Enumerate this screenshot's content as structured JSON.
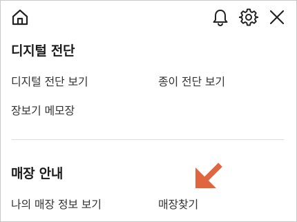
{
  "header": {
    "home_icon": "home-icon",
    "bell_icon": "bell-icon",
    "gear_icon": "gear-icon",
    "close_icon": "close-icon"
  },
  "digital_receipt": {
    "title": "디지털 전단",
    "links": [
      "디지털 전단 보기",
      "종이 전단 보기",
      "장보기 메모장"
    ]
  },
  "store_info": {
    "title": "매장 안내",
    "links": [
      "나의 매장 정보 보기",
      "매장찾기"
    ]
  },
  "annotation": {
    "icon": "arrow-icon",
    "color": "#e0663f"
  }
}
